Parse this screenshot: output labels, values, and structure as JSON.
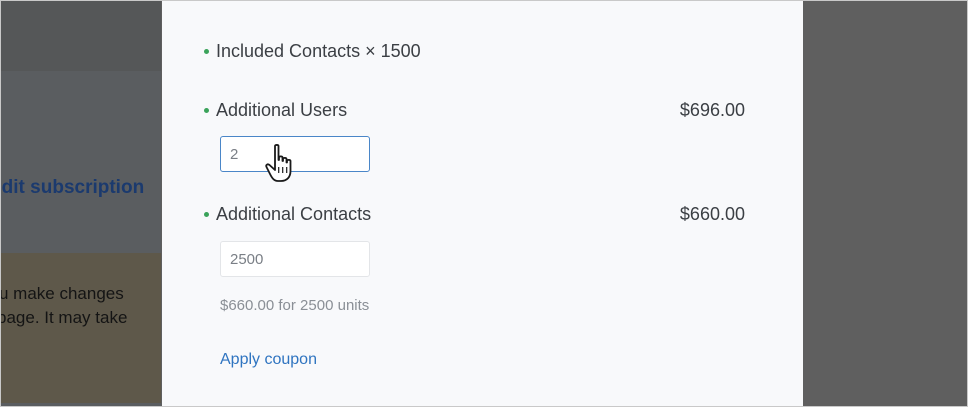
{
  "background": {
    "edit_link": "Edit subscription",
    "notice_lines": [
      "u make changes",
      "page. It may take"
    ]
  },
  "modal": {
    "included_contacts": {
      "label": "Included Contacts × 1500"
    },
    "additional_users": {
      "label": "Additional Users",
      "price": "$696.00",
      "value": "2"
    },
    "additional_contacts": {
      "label": "Additional Contacts",
      "price": "$660.00",
      "value": "2500",
      "hint": "$660.00 for 2500 units"
    },
    "apply_coupon": "Apply coupon"
  },
  "colors": {
    "accent": "#2f74c0",
    "bullet": "#3aa35a",
    "focus_border": "#4a86c8"
  },
  "icons": {
    "cursor": "hand-pointer-icon"
  }
}
